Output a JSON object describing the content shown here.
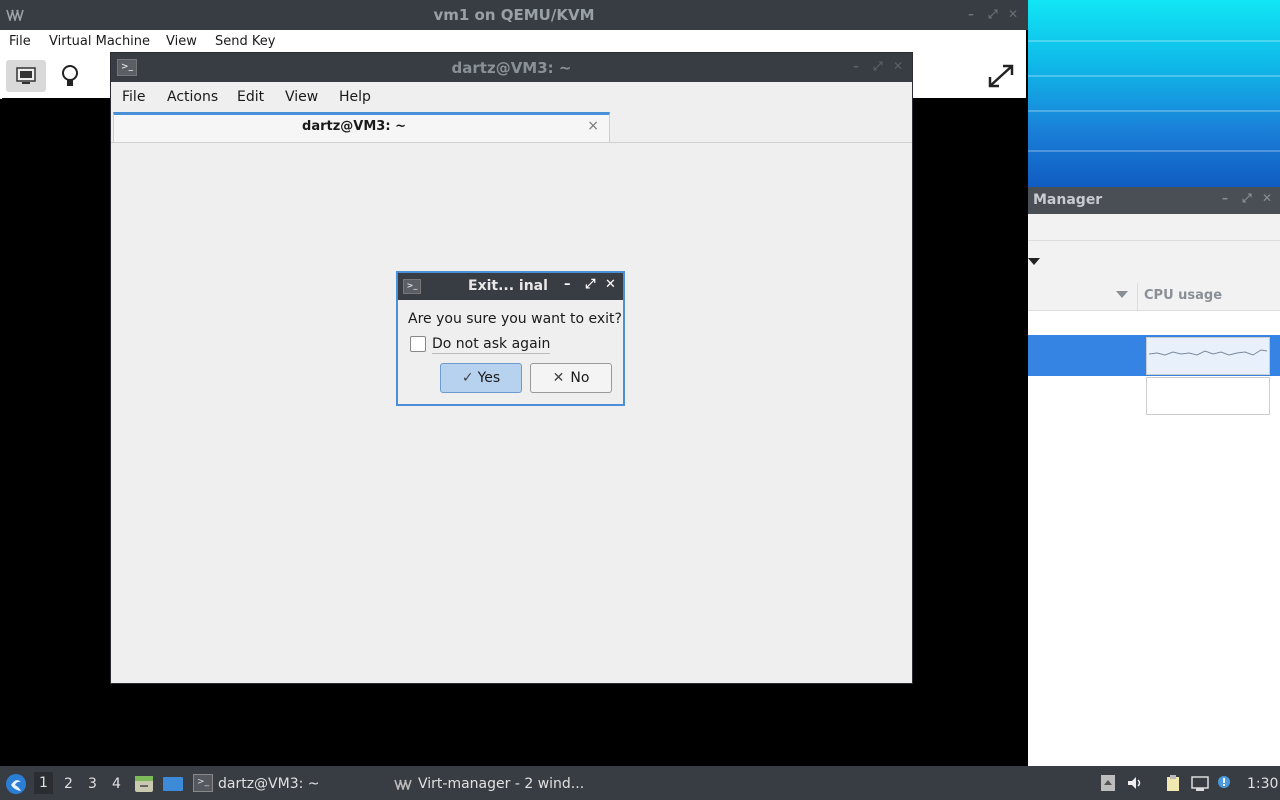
{
  "viewer": {
    "title": "vm1 on QEMU/KVM",
    "menu": [
      "File",
      "Virtual Machine",
      "View",
      "Send Key"
    ]
  },
  "manager": {
    "title": "Manager",
    "column_header": "CPU usage"
  },
  "terminal": {
    "title": "dartz@VM3: ~",
    "menu": [
      "File",
      "Actions",
      "Edit",
      "View",
      "Help"
    ],
    "tab_label": "dartz@VM3: ~",
    "tab_close": "×"
  },
  "dialog": {
    "title": "Exit...  inal",
    "message": "Are you sure you want to exit?",
    "checkbox_label": "Do not ask again",
    "yes_label": "Yes",
    "no_label": "No",
    "yes_icon": "✓",
    "no_icon": "✕"
  },
  "taskbar": {
    "workspaces": [
      "1",
      "2",
      "3",
      "4"
    ],
    "tasks": [
      "dartz@VM3: ~",
      "Virt-manager - 2 wind..."
    ],
    "clock": "1:30"
  }
}
